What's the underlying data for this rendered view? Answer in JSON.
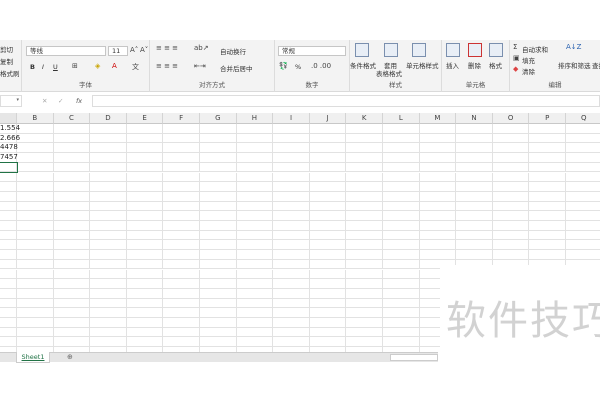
{
  "clipboard": {
    "cut": "剪切",
    "copy": "复制",
    "format_painter": "格式刷"
  },
  "font": {
    "name": "等线",
    "size": "11",
    "label": "字体",
    "bold": "B",
    "italic": "I",
    "underline": "U"
  },
  "alignment": {
    "wrap": "自动换行",
    "merge": "合并后居中",
    "label": "对齐方式"
  },
  "number": {
    "format": "常规",
    "percent": "%",
    "label": "数字"
  },
  "styles": {
    "conditional": "条件格式",
    "table_1": "套用",
    "table_2": "表格格式",
    "cell_styles": "单元格样式",
    "label": "样式"
  },
  "cells": {
    "insert": "插入",
    "delete": "删除",
    "format": "格式",
    "label": "单元格"
  },
  "editing": {
    "autosum": "自动求和",
    "fill": "填充",
    "clear": "清除",
    "sort": "排序和筛选",
    "find": "查找",
    "label": "编辑"
  },
  "formula_bar": {
    "fx": "fx",
    "cancel": "✕",
    "confirm": "✓"
  },
  "columns": [
    "B",
    "C",
    "D",
    "E",
    "F",
    "G",
    "H",
    "I",
    "J",
    "K",
    "L",
    "M",
    "N",
    "O",
    "P",
    "Q"
  ],
  "column_a_values": [
    "1.554",
    "2.666",
    "4478",
    "7457"
  ],
  "sheet_tab": "Sheet1",
  "add_sheet": "⊕",
  "watermark": "软件技巧"
}
